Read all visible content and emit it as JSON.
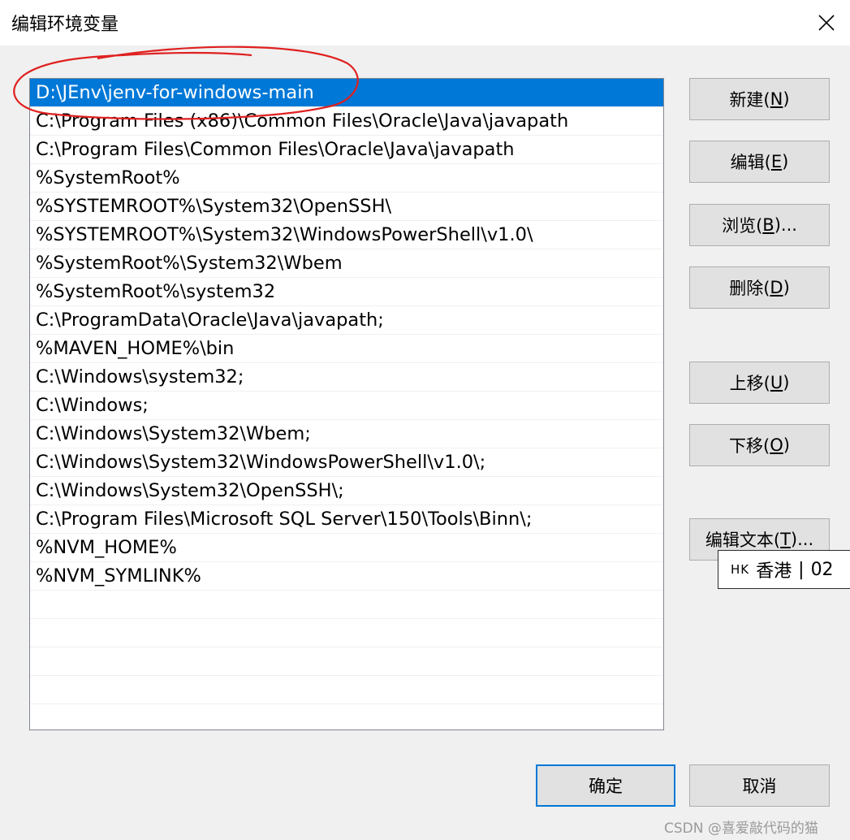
{
  "window": {
    "title": "编辑环境变量",
    "close_icon": "close-icon"
  },
  "path_list": {
    "selected_index": 0,
    "items": [
      "D:\\JEnv\\jenv-for-windows-main",
      "C:\\Program Files (x86)\\Common Files\\Oracle\\Java\\javapath",
      "C:\\Program Files\\Common Files\\Oracle\\Java\\javapath",
      "%SystemRoot%",
      "%SYSTEMROOT%\\System32\\OpenSSH\\",
      "%SYSTEMROOT%\\System32\\WindowsPowerShell\\v1.0\\",
      "%SystemRoot%\\System32\\Wbem",
      "%SystemRoot%\\system32",
      "C:\\ProgramData\\Oracle\\Java\\javapath;",
      "%MAVEN_HOME%\\bin",
      "C:\\Windows\\system32;",
      "C:\\Windows;",
      "C:\\Windows\\System32\\Wbem;",
      "C:\\Windows\\System32\\WindowsPowerShell\\v1.0\\;",
      "C:\\Windows\\System32\\OpenSSH\\;",
      "C:\\Program Files\\Microsoft SQL Server\\150\\Tools\\Binn\\;",
      "%NVM_HOME%",
      "%NVM_SYMLINK%"
    ]
  },
  "buttons": {
    "new": {
      "pre": "新建(",
      "key": "N",
      "post": ")"
    },
    "edit": {
      "pre": "编辑(",
      "key": "E",
      "post": ")"
    },
    "browse": {
      "pre": "浏览(",
      "key": "B",
      "post": ")..."
    },
    "delete": {
      "pre": "删除(",
      "key": "D",
      "post": ")"
    },
    "move_up": {
      "pre": "上移(",
      "key": "U",
      "post": ")"
    },
    "move_down": {
      "pre": "下移(",
      "key": "O",
      "post": ")"
    },
    "edit_text": {
      "pre": "编辑文本(",
      "key": "T",
      "post": ")..."
    },
    "ok": "确定",
    "cancel": "取消"
  },
  "ime_indicator": {
    "lang": "HK",
    "label": "香港",
    "separator": "|",
    "code": "02"
  },
  "watermark": "CSDN @喜爱敲代码的猫",
  "colors": {
    "selection": "#0078d7",
    "annotation": "#e02020",
    "button_face": "#e1e1e1",
    "dialog_bg": "#f0f0f0"
  }
}
